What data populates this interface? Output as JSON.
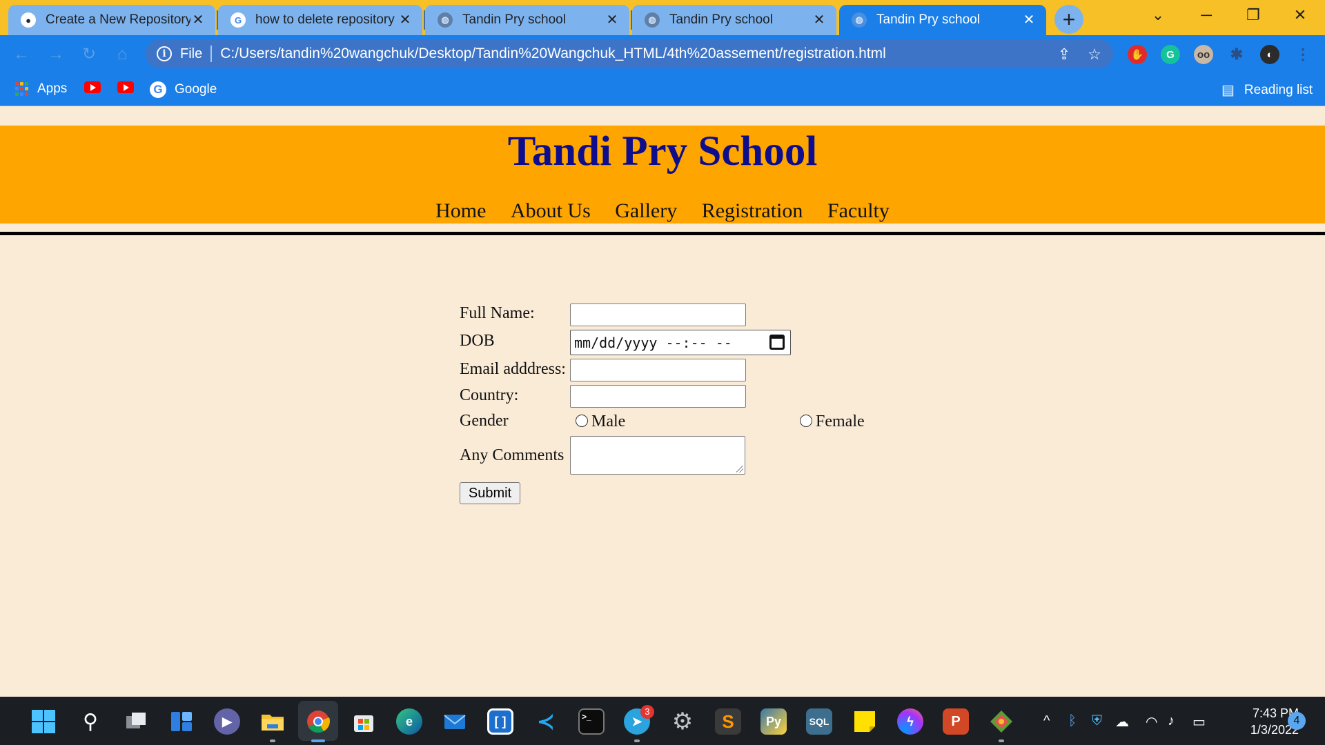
{
  "browser": {
    "tabs": [
      {
        "title": "Create a New Repository",
        "icon": "github-icon",
        "active": false
      },
      {
        "title": "how to delete repository i",
        "icon": "google-icon",
        "active": false
      },
      {
        "title": "Tandin Pry school",
        "icon": "globe-icon",
        "active": false
      },
      {
        "title": "Tandin Pry school",
        "icon": "globe-icon",
        "active": false
      },
      {
        "title": "Tandin Pry school",
        "icon": "globe-icon",
        "active": true
      }
    ],
    "address": {
      "scheme": "File",
      "url": "C:/Users/tandin%20wangchuk/Desktop/Tandin%20Wangchuk_HTML/4th%20assement/registration.html"
    },
    "bookmarks": {
      "apps": "Apps",
      "google": "Google",
      "reading_list": "Reading list"
    },
    "colors": {
      "tabbar": "#f6c026",
      "toolbar": "#1a7fe8"
    }
  },
  "site": {
    "title": "Tandi Pry School",
    "nav": [
      "Home",
      "About Us",
      "Gallery",
      "Registration",
      "Faculty"
    ],
    "colors": {
      "header": "#ffa500",
      "title": "#0e0e8c",
      "background": "#faebd7"
    }
  },
  "form": {
    "full_name_label": "Full Name:",
    "full_name_value": "",
    "dob_label": "DOB",
    "dob_placeholder": "mm/dd/yyyy --:-- --",
    "email_label": "Email adddress:",
    "email_value": "",
    "country_label": "Country:",
    "country_value": "",
    "gender_label": "Gender",
    "gender_options": [
      "Male",
      "Female"
    ],
    "comments_label": "Any Comments",
    "comments_value": "",
    "submit_label": "Submit"
  },
  "taskbar": {
    "telegram_badge": "3",
    "time": "7:43 PM",
    "date": "1/3/2022",
    "notifications": "4"
  }
}
